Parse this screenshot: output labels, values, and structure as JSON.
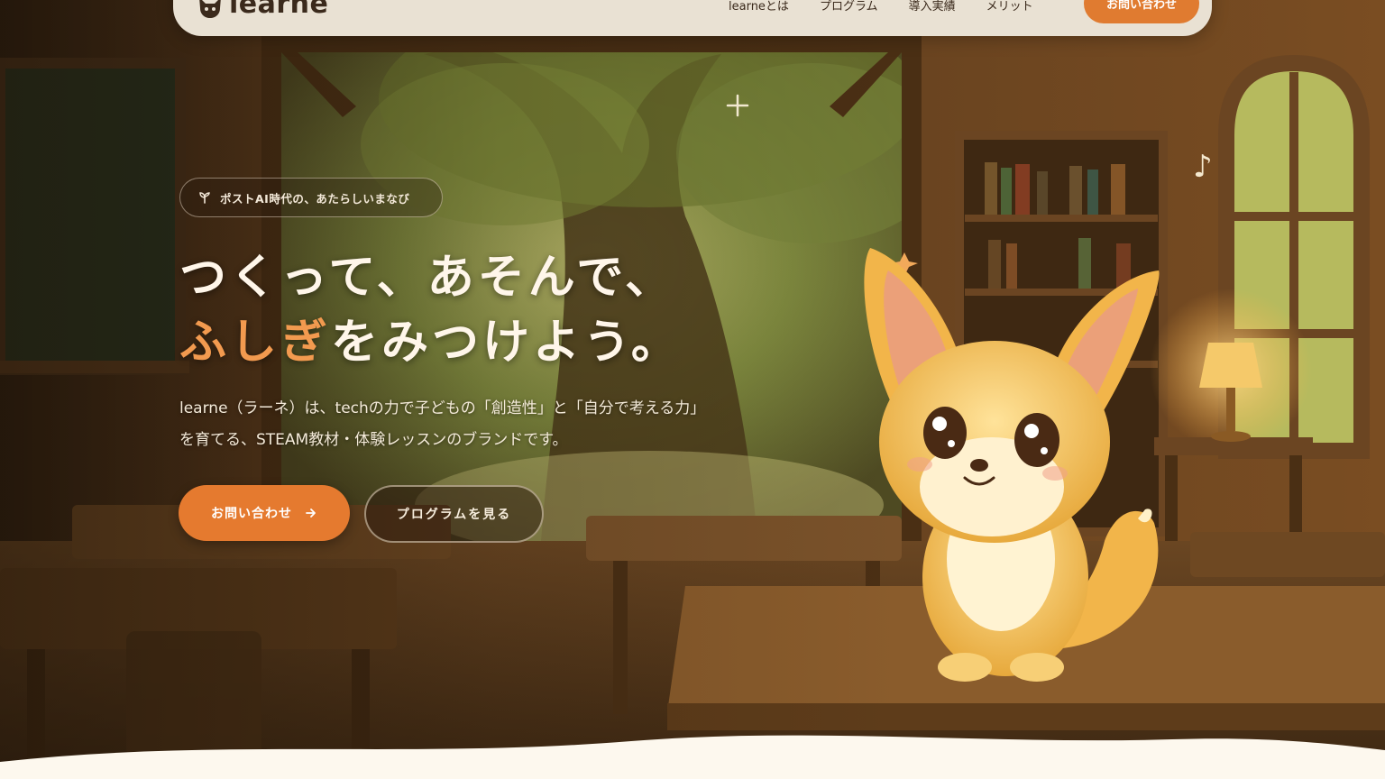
{
  "header": {
    "logo_text": "learne",
    "nav": [
      "learneとは",
      "プログラム",
      "導入実績",
      "メリット"
    ],
    "cta_label": "お問い合わせ"
  },
  "hero": {
    "badge": "ポストAI時代の、あたらしいまなび",
    "headline_line1": "つくって、あそんで、",
    "headline_line2_accent": "ふしぎ",
    "headline_line2_rest": "をみつけよう。",
    "lead_line1": "learne（ラーネ）は、techの力で子どもの「創造性」と「自分で考える力」",
    "lead_line2": "を育てる、STEAM教材・体験レッスンのブランドです。",
    "primary_button": "お問い合わせ",
    "secondary_button": "プログラムを見る"
  },
  "colors": {
    "accent": "#e57a2f",
    "headline_accent": "#f29a4f",
    "nav_background": "#e9e1d3",
    "page_bottom": "#fdf8ee"
  },
  "icons": {
    "logo": "fox-head-icon",
    "badge": "sprout-icon",
    "primary_button": "arrow-right-icon"
  }
}
